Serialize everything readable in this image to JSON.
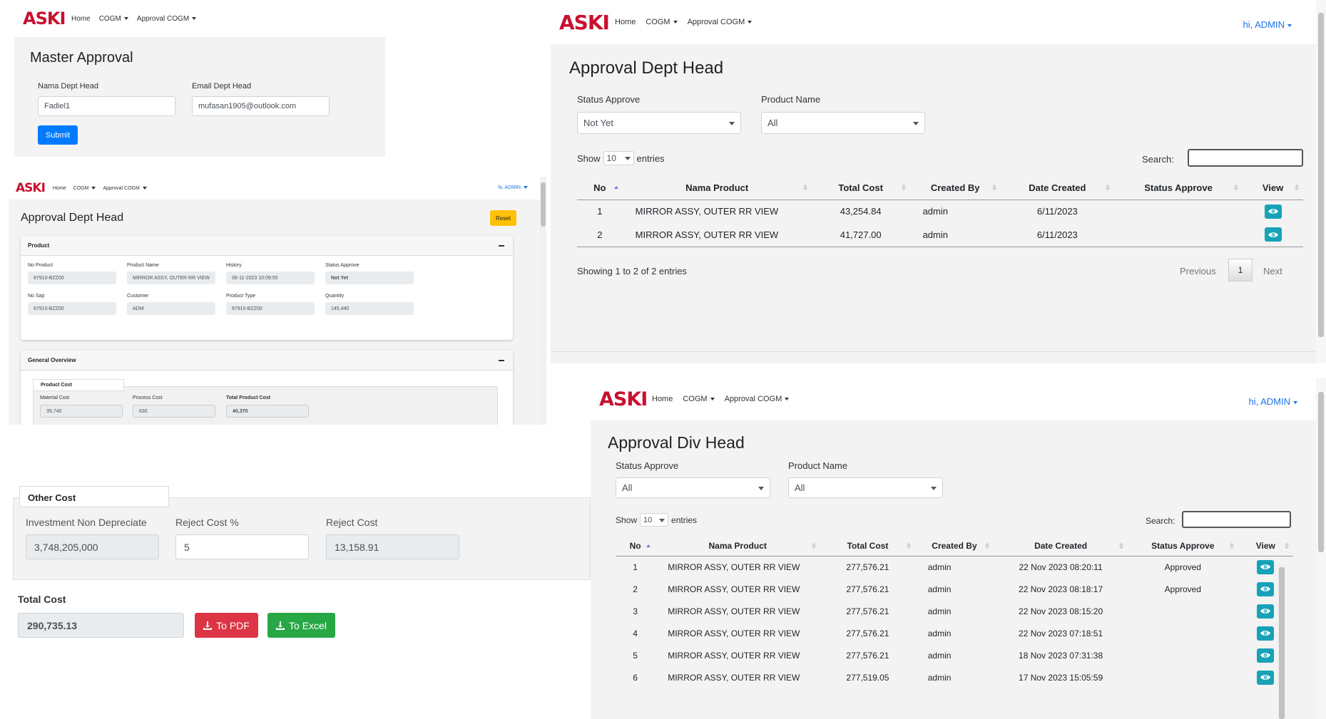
{
  "brand": {
    "logo": "ASKI",
    "logo_color": "#c8102e"
  },
  "nav": {
    "home": "Home",
    "cogm": "COGM",
    "approval": "Approval COGM",
    "user": "hi, ADMIN"
  },
  "colors": {
    "primary": "#007bff",
    "info": "#17a2b8",
    "danger": "#dc3545",
    "success": "#28a745",
    "warning": "#ffc107"
  },
  "master": {
    "title": "Master Approval",
    "name_label": "Nama Dept Head",
    "name_value": "Fadiel1",
    "email_label": "Email Dept Head",
    "email_value": "mufasan1905@outlook.com",
    "submit": "Submit"
  },
  "dept_detail": {
    "title": "Approval Dept Head",
    "reset": "Reset",
    "product_card": "Product",
    "fields": [
      {
        "label": "No Product",
        "value": "87910-BZZ00"
      },
      {
        "label": "Product Name",
        "value": "MIRROR ASSY, OUTER RR VIEW"
      },
      {
        "label": "History",
        "value": "06-11-2023 10:09:55"
      },
      {
        "label": "Status Approve",
        "value": "Not Yet"
      },
      {
        "label": "No Sap",
        "value": "87910-BZZ00"
      },
      {
        "label": "Customer",
        "value": "ADM"
      },
      {
        "label": "Product Type",
        "value": "87910-BZZ00"
      },
      {
        "label": "Quantity",
        "value": "145,440"
      }
    ],
    "overview_card": "General Overview",
    "product_cost_tab": "Product Cost",
    "cost_fields": [
      {
        "label": "Material Cost",
        "value": "39,740"
      },
      {
        "label": "Process Cost",
        "value": "630"
      },
      {
        "label": "Total Product Cost",
        "value": "40,370"
      }
    ]
  },
  "other_cost": {
    "tab": "Other Cost",
    "fields": [
      {
        "label": "Investment Non Depreciate",
        "value": "3,748,205,000"
      },
      {
        "label": "Reject Cost %",
        "value": "5"
      },
      {
        "label": "Reject Cost",
        "value": "13,158.91"
      }
    ],
    "total_label": "Total Cost",
    "total_value": "290,735.13",
    "pdf": "To PDF",
    "excel": "To Excel"
  },
  "dept_list": {
    "title": "Approval Dept Head",
    "status_label": "Status Approve",
    "status_value": "Not Yet",
    "product_label": "Product Name",
    "product_value": "All",
    "show": "Show",
    "entries_value": "10",
    "entries": "entries",
    "search": "Search:",
    "columns": [
      "No",
      "Nama Product",
      "Total Cost",
      "Created By",
      "Date Created",
      "Status Approve",
      "View"
    ],
    "rows": [
      {
        "no": "1",
        "name": "MIRROR ASSY, OUTER RR VIEW",
        "cost": "43,254.84",
        "by": "admin",
        "date": "6/11/2023",
        "status": ""
      },
      {
        "no": "2",
        "name": "MIRROR ASSY, OUTER RR VIEW",
        "cost": "41,727.00",
        "by": "admin",
        "date": "6/11/2023",
        "status": ""
      }
    ],
    "info": "Showing 1 to 2 of 2 entries",
    "previous": "Previous",
    "page": "1",
    "next": "Next"
  },
  "div_list": {
    "title": "Approval Div Head",
    "status_label": "Status Approve",
    "status_value": "All",
    "product_label": "Product Name",
    "product_value": "All",
    "show": "Show",
    "entries_value": "10",
    "entries": "entries",
    "search": "Search:",
    "columns": [
      "No",
      "Nama Product",
      "Total Cost",
      "Created By",
      "Date Created",
      "Status Approve",
      "View"
    ],
    "rows": [
      {
        "no": "1",
        "name": "MIRROR ASSY, OUTER RR VIEW",
        "cost": "277,576.21",
        "by": "admin",
        "date": "22 Nov 2023 08:20:11",
        "status": "Approved"
      },
      {
        "no": "2",
        "name": "MIRROR ASSY, OUTER RR VIEW",
        "cost": "277,576.21",
        "by": "admin",
        "date": "22 Nov 2023 08:18:17",
        "status": "Approved"
      },
      {
        "no": "3",
        "name": "MIRROR ASSY, OUTER RR VIEW",
        "cost": "277,576.21",
        "by": "admin",
        "date": "22 Nov 2023 08:15:20",
        "status": ""
      },
      {
        "no": "4",
        "name": "MIRROR ASSY, OUTER RR VIEW",
        "cost": "277,576.21",
        "by": "admin",
        "date": "22 Nov 2023 07:18:51",
        "status": ""
      },
      {
        "no": "5",
        "name": "MIRROR ASSY, OUTER RR VIEW",
        "cost": "277,576.21",
        "by": "admin",
        "date": "18 Nov 2023 07:31:38",
        "status": ""
      },
      {
        "no": "6",
        "name": "MIRROR ASSY, OUTER RR VIEW",
        "cost": "277,519.05",
        "by": "admin",
        "date": "17 Nov 2023 15:05:59",
        "status": ""
      }
    ]
  }
}
